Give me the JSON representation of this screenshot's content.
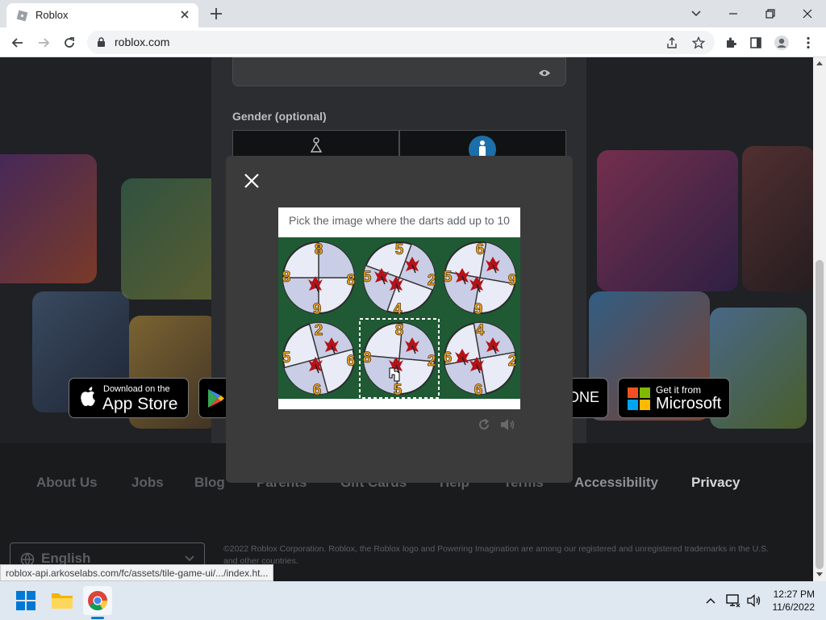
{
  "browser": {
    "tab_title": "Roblox",
    "url": "roblox.com",
    "status_url": "roblox-api.arkoselabs.com/fc/assets/tile-game-ui/.../index.ht..."
  },
  "signup": {
    "gender_label": "Gender (optional)"
  },
  "stores": {
    "apple_small": "Download on the",
    "apple_big": "App Store",
    "xbox_partial": "ONE",
    "microsoft_small": "Get it from",
    "microsoft_big": "Microsoft"
  },
  "footer": {
    "links": [
      "About Us",
      "Jobs",
      "Blog",
      "Parents",
      "Gift Cards",
      "Help",
      "Terms",
      "Accessibility",
      "Privacy"
    ],
    "language": "English",
    "copyright": "©2022 Roblox Corporation. Roblox, the Roblox logo and Powering Imagination are among our registered and unregistered trademarks in the U.S. and other countries."
  },
  "captcha": {
    "prompt": "Pick the image where the darts add up to 10",
    "tiles": [
      {
        "numbers": [
          "8",
          "8",
          "9",
          "8"
        ],
        "darts": 1,
        "rot": 0
      },
      {
        "numbers": [
          "5",
          "2",
          "4",
          "5"
        ],
        "darts": 3,
        "rot": 20
      },
      {
        "numbers": [
          "6",
          "9",
          "9",
          "5"
        ],
        "darts": 3,
        "rot": 10
      },
      {
        "numbers": [
          "2",
          "6",
          "6",
          "5"
        ],
        "darts": 2,
        "rot": -15
      },
      {
        "numbers": [
          "8",
          "2",
          "5",
          "8"
        ],
        "darts": 2,
        "rot": 5
      },
      {
        "numbers": [
          "4",
          "2",
          "6",
          "6"
        ],
        "darts": 3,
        "rot": -10
      }
    ],
    "selected_tile": 4
  },
  "taskbar": {
    "time": "12:27 PM",
    "date": "11/6/2022"
  },
  "colors": {
    "chrome_frame": "#dee1e6",
    "page_bg": "#1f2125",
    "modal_bg": "#3b3b3b",
    "board_green": "#1f5a34",
    "dart_red": "#b31217",
    "number_orange": "#f0a830"
  }
}
